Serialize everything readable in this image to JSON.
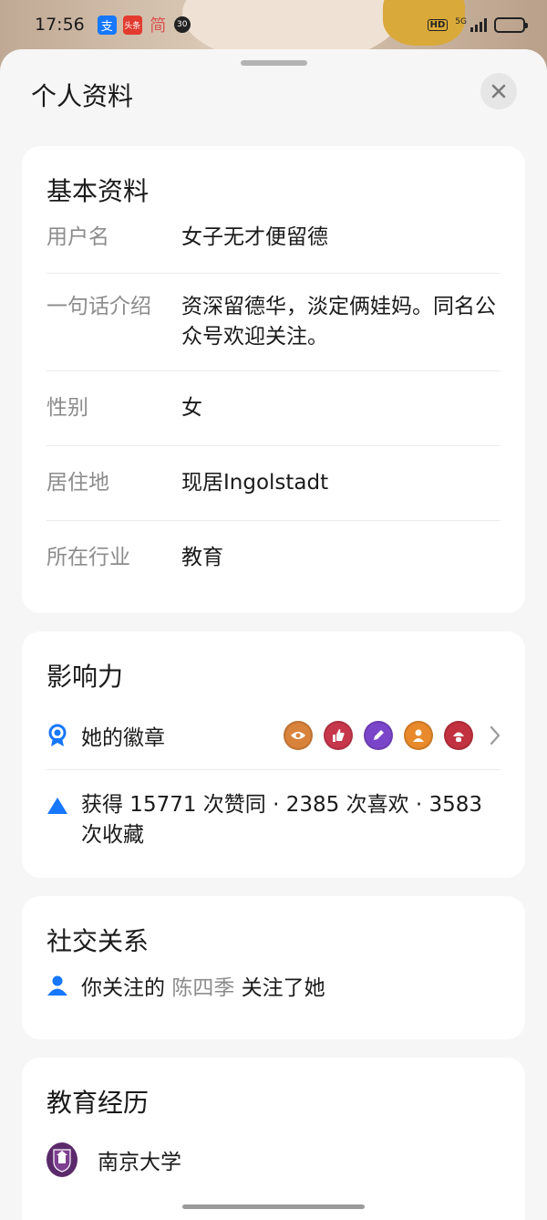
{
  "status_bar": {
    "time": "17:56",
    "app_badges": [
      "支",
      "头条",
      "简",
      "30"
    ],
    "network": "5G",
    "hd": "HD",
    "battery_level": 0.2
  },
  "sheet": {
    "title": "个人资料"
  },
  "basic_info": {
    "title": "基本资料",
    "rows": [
      {
        "label": "用户名",
        "value": "女子无才便留德"
      },
      {
        "label": "一句话介绍",
        "value": "资深留德华，淡定俩娃妈。同名公众号欢迎关注。"
      },
      {
        "label": "性别",
        "value": "女"
      },
      {
        "label": "居住地",
        "value": "现居Ingolstadt"
      },
      {
        "label": "所在行业",
        "value": "教育"
      }
    ]
  },
  "influence": {
    "title": "影响力",
    "badges_label": "她的徽章",
    "badge_icons": [
      "eye-medal",
      "thumbs-up-medal",
      "pen-medal",
      "person-medal",
      "helmet-medal"
    ],
    "stats_text": "获得 15771 次赞同 · 2385 次喜欢 · 3583 次收藏"
  },
  "social": {
    "title": "社交关系",
    "prefix": "你关注的",
    "name": "陈四季",
    "suffix": "关注了她"
  },
  "education": {
    "title": "教育经历",
    "school": "南京大学"
  },
  "colors": {
    "accent_blue": "#1677ff",
    "muted_text": "#8c8c8c",
    "card_bg": "#ffffff",
    "sheet_bg": "#f6f6f6"
  }
}
